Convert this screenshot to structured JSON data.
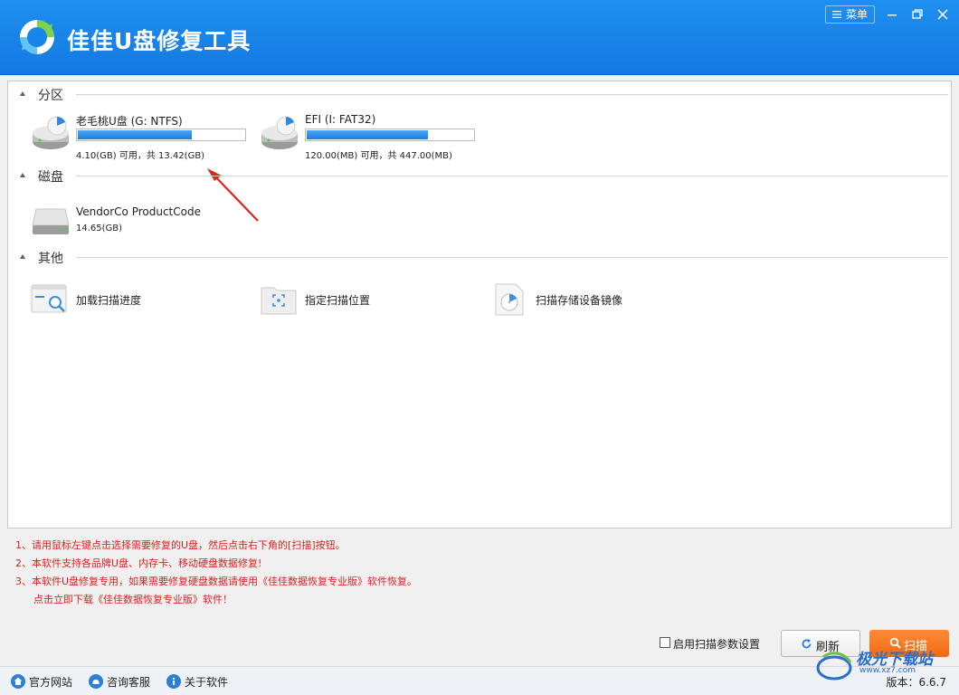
{
  "app": {
    "title": "佳佳U盘修复工具",
    "menu_label": "菜单"
  },
  "sections": {
    "partition": "分区",
    "disk": "磁盘",
    "other": "其他"
  },
  "partitions": [
    {
      "name": "老毛桃U盘 (G: NTFS)",
      "size": "4.10(GB) 可用，共 13.42(GB)",
      "used_fraction": 0.69
    },
    {
      "name": "EFI (I: FAT32)",
      "size": "120.00(MB) 可用，共 447.00(MB)",
      "used_fraction": 0.73
    }
  ],
  "disks": [
    {
      "name": "VendorCo ProductCode",
      "size": "14.65(GB)"
    }
  ],
  "others": [
    {
      "label": "加载扫描进度",
      "icon": "load-progress-icon"
    },
    {
      "label": "指定扫描位置",
      "icon": "folder-target-icon"
    },
    {
      "label": "扫描存储设备镜像",
      "icon": "disk-image-icon"
    }
  ],
  "notes": [
    "1、请用鼠标左键点击选择需要修复的U盘，然后点击右下角的[扫描]按钮。",
    "2、本软件支持各品牌U盘、内存卡、移动硬盘数据修复!",
    "3、本软件U盘修复专用，如果需要修复硬盘数据请使用《佳佳数据恢复专业版》软件恢复。",
    "点击立即下载《佳佳数据恢复专业版》软件！"
  ],
  "controls": {
    "scan_params_label": "启用扫描参数设置",
    "scan_params_checked": false,
    "refresh_label": "刷新",
    "scan_label": "扫描"
  },
  "statusbar": {
    "website": "官方网站",
    "support": "咨询客服",
    "about": "关于软件",
    "version": "版本：6.6.7"
  },
  "watermark": {
    "text": "极光下载站",
    "url": "www.xz7.com"
  },
  "colors": {
    "titlebar": "#1478e0",
    "scan_button": "#f26a10",
    "note_text": "#e02020",
    "bar_fill": "#1a7ee0"
  }
}
